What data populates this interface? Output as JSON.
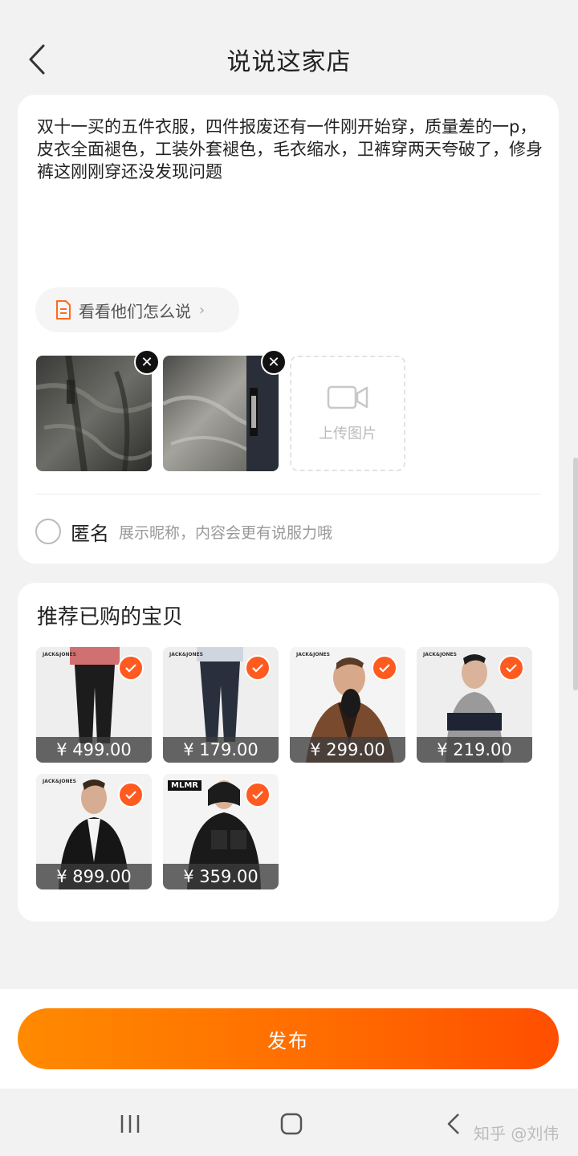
{
  "header": {
    "title": "说说这家店"
  },
  "review": {
    "text": "双十一买的五件衣服，四件报废还有一件刚开始穿，质量差的一p，皮衣全面褪色，工装外套褪色，毛衣缩水，卫裤穿两天夸破了，修身裤这刚刚穿还没发现问题",
    "see_others_label": "看看他们怎么说",
    "upload_label": "上传图片",
    "anonymous_label": "匿名",
    "anonymous_hint": "展示昵称，内容会更有说服力哦"
  },
  "recommend": {
    "title": "推荐已购的宝贝",
    "products": [
      {
        "price": "¥ 499.00",
        "brand": "JACK&JONES"
      },
      {
        "price": "¥ 179.00",
        "brand": "JACK&JONES"
      },
      {
        "price": "¥ 299.00",
        "brand": "JACK&JONES"
      },
      {
        "price": "¥ 219.00",
        "brand": "JACK&JONES"
      },
      {
        "price": "¥ 899.00",
        "brand": "JACK&JONES"
      },
      {
        "price": "¥ 359.00",
        "brand": "MLMR"
      }
    ]
  },
  "publish_label": "发布",
  "watermark": "知乎 @刘伟",
  "colors": {
    "accent": "#ff5a1f",
    "publish_start": "#ff8a00",
    "publish_end": "#ff4e00"
  }
}
